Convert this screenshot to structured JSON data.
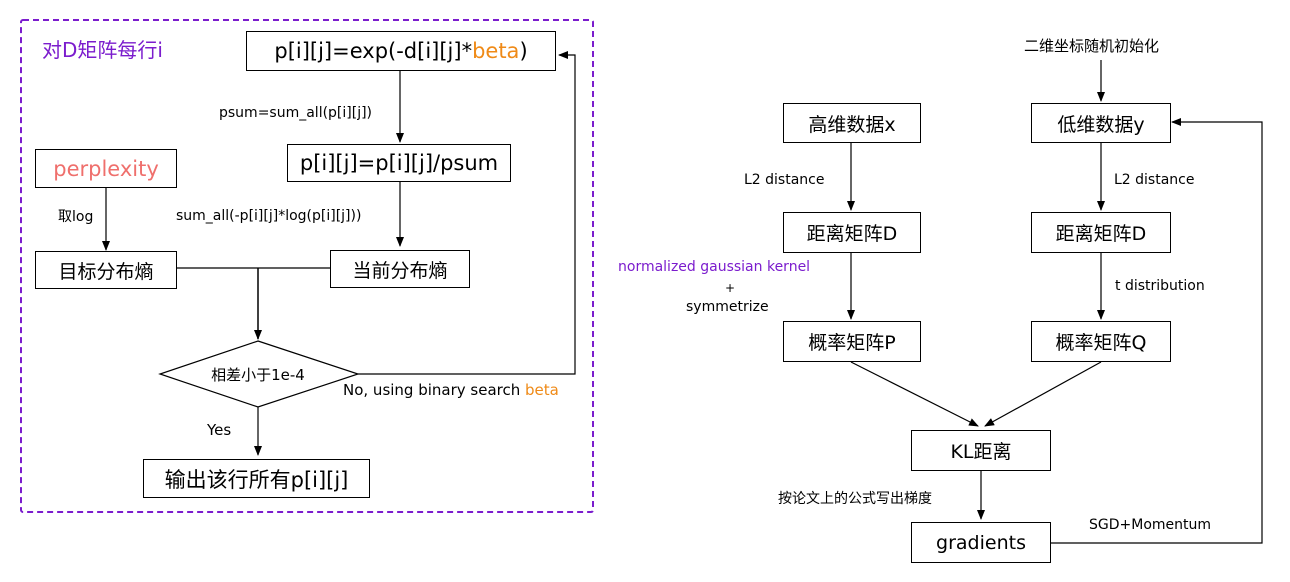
{
  "left": {
    "frame_title": "对D矩阵每行i",
    "exp_prefix": "p[i][j]=exp(-d[i][j]*",
    "beta": "beta",
    "exp_suffix": ")",
    "psum_label": "psum=sum_all(p[i][j])",
    "normalize": "p[i][j]=p[i][j]/psum",
    "perplexity": "perplexity",
    "take_log": "取log",
    "entropy_label": "sum_all(-p[i][j]*log(p[i][j]))",
    "target_entropy": "目标分布熵",
    "current_entropy": "当前分布熵",
    "decision": "相差小于1e-4",
    "no_prefix": "No, using binary search ",
    "no_beta": "beta",
    "yes": "Yes",
    "output": "输出该行所有p[i][j]"
  },
  "right": {
    "init": "二维坐标随机初始化",
    "high_data": "高维数据x",
    "low_data": "低维数据y",
    "l2_left": "L2 distance",
    "l2_right": "L2 distance",
    "dist_left": "距离矩阵D",
    "dist_right": "距离矩阵D",
    "gauss": "normalized gaussian kernel",
    "plus": "+",
    "symmetrize": "symmetrize",
    "t_dist": "t distribution",
    "prob_p": "概率矩阵P",
    "prob_q": "概率矩阵Q",
    "kl": "KL距离",
    "grad_formula": "按论文上的公式写出梯度",
    "gradients": "gradients",
    "sgd": "SGD+Momentum"
  },
  "colors": {
    "frame": "#7b1ccd",
    "beta": "#ef8a17",
    "perplexity": "#ef6f6c",
    "gauss": "#7b1ccd",
    "line": "#000000"
  }
}
